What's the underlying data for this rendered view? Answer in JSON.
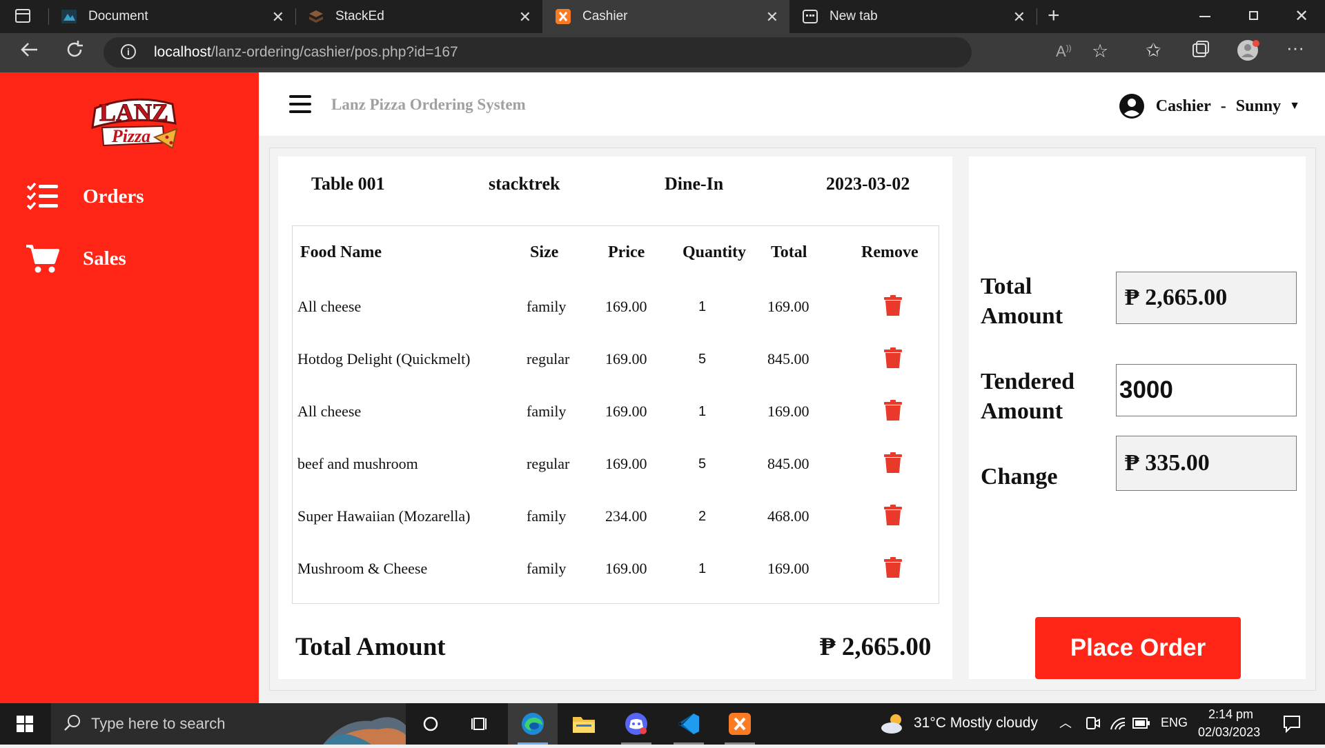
{
  "browser": {
    "tabs": [
      {
        "title": "Document",
        "icon": "document-favicon"
      },
      {
        "title": "StackEd",
        "icon": "stacked-favicon"
      },
      {
        "title": "Cashier",
        "icon": "xampp-favicon",
        "active": true
      },
      {
        "title": "New tab",
        "icon": "new-tab-favicon"
      }
    ],
    "url_host": "localhost",
    "url_path": "/lanz-ordering/cashier/pos.php?id=167"
  },
  "sidebar": {
    "logo_top": "LANZ",
    "logo_bottom": "Pizza",
    "items": [
      {
        "label": "Orders",
        "icon": "checklist-icon"
      },
      {
        "label": "Sales",
        "icon": "cart-icon"
      }
    ]
  },
  "header": {
    "title": "Lanz Pizza Ordering System",
    "role": "Cashier",
    "separator": "-",
    "username": "Sunny"
  },
  "order": {
    "table": "Table 001",
    "customer": "stacktrek",
    "type": "Dine-In",
    "date": "2023-03-02",
    "columns": [
      "Food Name",
      "Size",
      "Price",
      "Quantity",
      "Total",
      "Remove"
    ],
    "items": [
      {
        "name": "All cheese",
        "size": "family",
        "price": "169.00",
        "qty": "1",
        "total": "169.00"
      },
      {
        "name": "Hotdog Delight (Quickmelt)",
        "size": "regular",
        "price": "169.00",
        "qty": "5",
        "total": "845.00"
      },
      {
        "name": "All cheese",
        "size": "family",
        "price": "169.00",
        "qty": "1",
        "total": "169.00"
      },
      {
        "name": "beef and mushroom",
        "size": "regular",
        "price": "169.00",
        "qty": "5",
        "total": "845.00"
      },
      {
        "name": "Super Hawaiian (Mozarella)",
        "size": "family",
        "price": "234.00",
        "qty": "2",
        "total": "468.00"
      },
      {
        "name": "Mushroom & Cheese",
        "size": "family",
        "price": "169.00",
        "qty": "1",
        "total": "169.00"
      }
    ],
    "total_label": "Total Amount",
    "total_value": "₱ 2,665.00"
  },
  "payment": {
    "total_label_1": "Total",
    "total_label_2": "Amount",
    "total_value": "₱ 2,665.00",
    "tendered_label_1": "Tendered",
    "tendered_label_2": "Amount",
    "tendered_value": "3000",
    "change_label": "Change",
    "change_value": "₱ 335.00",
    "place_order_label": "Place Order"
  },
  "taskbar": {
    "search_placeholder": "Type here to search",
    "weather": "31°C  Mostly cloudy",
    "language": "ENG",
    "time": "2:14 pm",
    "date": "02/03/2023"
  },
  "colors": {
    "brand_red": "#ff2618",
    "trash_red": "#e8392b"
  }
}
